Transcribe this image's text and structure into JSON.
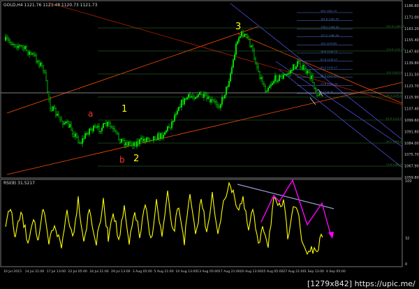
{
  "header": {
    "title": "GOLD,H4 1121.76 1123.48 1120.73 1121.73"
  },
  "rsi_header": {
    "title": "RSI(8) 31.5217"
  },
  "price_axis": {
    "labels": [
      "1186.80",
      "1171.00",
      "1163.20",
      "1155.40",
      "1147.60",
      "1139.80",
      "1131.50",
      "1123.70",
      "1115.90",
      "1107.40",
      "1099.60",
      "1091.80",
      "1084.00",
      "1075.70",
      "1067.90",
      "1059.80"
    ]
  },
  "rsi_axis": {
    "labels": [
      "100",
      "32",
      "0"
    ]
  },
  "time_axis": {
    "labels": [
      "10 Jul 2015",
      "14 Jul 21:00",
      "17 Jul 13:00",
      "22 Jul 05:00",
      "24 Jul 21:00",
      "29 Jul 13:00",
      "3 Aug 05:00",
      "5 Aug 21:00",
      "10 Aug 13:00",
      "13 Aug 05:00",
      "17 Aug 21:00",
      "20 Aug 13:00",
      "25 Aug 05:00",
      "27 Aug 21:00",
      "1 Sep 13:00",
      "4 Sep 05:00"
    ]
  },
  "wave_labels": {
    "w1": "1",
    "w2": "2",
    "w3": "3",
    "wa": "a",
    "wb": "b"
  },
  "fib_upper": [
    "200  1181.13",
    "161.8  1161.45",
    "138.2  1164.43",
    "127.2  1160.93",
    "100  1147.64",
    "78.6  1140.70",
    "61.8  1135.27",
    "50.0  1131.17",
    "38.2  1127.45",
    "23.6  1122.34",
    "0  1114.35"
  ],
  "fib_lower": [
    "161.8  1169.46",
    "123.6  1152.34",
    "100  1142.14",
    "76.4  1125.31",
    "61.8  1114.37",
    "38.2  1099.45",
    "23.6  1088.30"
  ],
  "watermark": {
    "text": "[1279x842] https://upic.me/"
  },
  "colors": {
    "candle": "#00e000",
    "rsi_line": "#ffff00",
    "trend_line": "#ff5000",
    "channel_line": "#6a6aff",
    "wave_num": "#ffff00",
    "wave_letter": "#ff3030",
    "magenta": "#ff00ff"
  }
}
